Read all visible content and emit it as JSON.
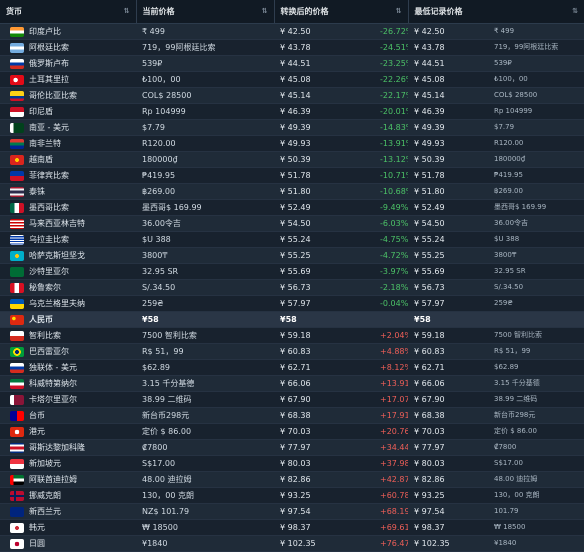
{
  "headers": {
    "currency": "货币",
    "price": "当前价格",
    "converted": "转换后的价格",
    "lowest": "最低记录价格"
  },
  "rows": [
    {
      "name": "印度卢比",
      "price": "₹ 499",
      "converted": "¥ 42.50",
      "pct": "-26.72%",
      "trend": "neg",
      "low": "¥ 42.50",
      "low_raw": "₹ 499",
      "flag": "flag-india"
    },
    {
      "name": "阿根廷比索",
      "price": "719，99阿根廷比索",
      "converted": "¥ 43.78",
      "pct": "-24.51%",
      "trend": "neg",
      "low": "¥ 43.78",
      "low_raw": "719，99阿根廷比索",
      "flag": "flag-argentina"
    },
    {
      "name": "俄罗斯卢布",
      "price": "539₽",
      "converted": "¥ 44.51",
      "pct": "-23.25%",
      "trend": "neg",
      "low": "¥ 44.51",
      "low_raw": "539₽",
      "flag": "flag-russia"
    },
    {
      "name": "土耳其里拉",
      "price": "₺100，00",
      "converted": "¥ 45.08",
      "pct": "-22.26%",
      "trend": "neg",
      "low": "¥ 45.08",
      "low_raw": "₺100，00",
      "flag": "flag-turkey"
    },
    {
      "name": "哥伦比亚比索",
      "price": "COL$ 28500",
      "converted": "¥ 45.14",
      "pct": "-22.17%",
      "trend": "neg",
      "low": "¥ 45.14",
      "low_raw": "COL$ 28500",
      "flag": "flag-colombia"
    },
    {
      "name": "印尼盾",
      "price": "Rp 104999",
      "converted": "¥ 46.39",
      "pct": "-20.01%",
      "trend": "neg",
      "low": "¥ 46.39",
      "low_raw": "Rp 104999",
      "flag": "flag-indonesia"
    },
    {
      "name": "南亚 - 美元",
      "price": "$7.79",
      "converted": "¥ 49.39",
      "pct": "-14.83%",
      "trend": "neg",
      "low": "¥ 49.39",
      "low_raw": "$7.79",
      "flag": "flag-pakistan"
    },
    {
      "name": "南非兰特",
      "price": "R120.00",
      "converted": "¥ 49.93",
      "pct": "-13.91%",
      "trend": "neg",
      "low": "¥ 49.93",
      "low_raw": "R120.00",
      "flag": "flag-southafrica"
    },
    {
      "name": "越南盾",
      "price": "180000₫",
      "converted": "¥ 50.39",
      "pct": "-13.12%",
      "trend": "neg",
      "low": "¥ 50.39",
      "low_raw": "180000₫",
      "flag": "flag-vietnam"
    },
    {
      "name": "菲律宾比索",
      "price": "₱419.95",
      "converted": "¥ 51.78",
      "pct": "-10.71%",
      "trend": "neg",
      "low": "¥ 51.78",
      "low_raw": "₱419.95",
      "flag": "flag-philippines"
    },
    {
      "name": "泰铢",
      "price": "฿269.00",
      "converted": "¥ 51.80",
      "pct": "-10.68%",
      "trend": "neg",
      "low": "¥ 51.80",
      "low_raw": "฿269.00",
      "flag": "flag-thailand"
    },
    {
      "name": "墨西哥比索",
      "price": "墨西哥$ 169.99",
      "converted": "¥ 52.49",
      "pct": "-9.49%",
      "trend": "neg",
      "low": "¥ 52.49",
      "low_raw": "墨西哥$ 169.99",
      "flag": "flag-mexico"
    },
    {
      "name": "马来西亚林吉特",
      "price": "36.00令吉",
      "converted": "¥ 54.50",
      "pct": "-6.03%",
      "trend": "neg",
      "low": "¥ 54.50",
      "low_raw": "36.00令吉",
      "flag": "flag-malaysia"
    },
    {
      "name": "乌拉圭比索",
      "price": "$U 388",
      "converted": "¥ 55.24",
      "pct": "-4.75%",
      "trend": "neg",
      "low": "¥ 55.24",
      "low_raw": "$U 388",
      "flag": "flag-uruguay"
    },
    {
      "name": "哈萨克斯坦坚戈",
      "price": "3800₸",
      "converted": "¥ 55.25",
      "pct": "-4.72%",
      "trend": "neg",
      "low": "¥ 55.25",
      "low_raw": "3800₸",
      "flag": "flag-kazakhstan"
    },
    {
      "name": "沙特里亚尔",
      "price": "32.95 SR",
      "converted": "¥ 55.69",
      "pct": "-3.97%",
      "trend": "neg",
      "low": "¥ 55.69",
      "low_raw": "32.95 SR",
      "flag": "flag-saudi"
    },
    {
      "name": "秘鲁索尔",
      "price": "S/.34.50",
      "converted": "¥ 56.73",
      "pct": "-2.18%",
      "trend": "neg",
      "low": "¥ 56.73",
      "low_raw": "S/.34.50",
      "flag": "flag-peru"
    },
    {
      "name": "乌克兰格里夫纳",
      "price": "259₴",
      "converted": "¥ 57.97",
      "pct": "-0.04%",
      "trend": "neg",
      "low": "¥ 57.97",
      "low_raw": "259₴",
      "flag": "flag-ukraine"
    },
    {
      "name": "人民币",
      "price": "¥58",
      "converted": "¥58",
      "pct": "",
      "trend": "flat",
      "low": "¥58",
      "low_raw": "",
      "flag": "flag-china",
      "highlight": true
    },
    {
      "name": "智利比索",
      "price": "7500 智利比索",
      "converted": "¥ 59.18",
      "pct": "+2.04%",
      "trend": "pos",
      "low": "¥ 59.18",
      "low_raw": "7500 智利比索",
      "flag": "flag-chile"
    },
    {
      "name": "巴西雷亚尔",
      "price": "R$ 51，99",
      "converted": "¥ 60.83",
      "pct": "+4.88%",
      "trend": "pos",
      "low": "¥ 60.83",
      "low_raw": "R$ 51，99",
      "flag": "flag-brazil"
    },
    {
      "name": "独联体 - 美元",
      "price": "$62.89",
      "converted": "¥ 62.71",
      "pct": "+8.12%",
      "trend": "pos",
      "low": "¥ 62.71",
      "low_raw": "$62.89",
      "flag": "flag-cis"
    },
    {
      "name": "科威特第纳尔",
      "price": "3.15 千分基德",
      "converted": "¥ 66.06",
      "pct": "+13.91%",
      "trend": "pos",
      "low": "¥ 66.06",
      "low_raw": "3.15 千分基德",
      "flag": "flag-kuwait"
    },
    {
      "name": "卡塔尔里亚尔",
      "price": "38.99 二维码",
      "converted": "¥ 67.90",
      "pct": "+17.07%",
      "trend": "pos",
      "low": "¥ 67.90",
      "low_raw": "38.99 二维码",
      "flag": "flag-qatar"
    },
    {
      "name": "台币",
      "price": "新台币298元",
      "converted": "¥ 68.38",
      "pct": "+17.91%",
      "trend": "pos",
      "low": "¥ 68.38",
      "low_raw": "新台币298元",
      "flag": "flag-taiwan"
    },
    {
      "name": "港元",
      "price": "定价 $ 86.00",
      "converted": "¥ 70.03",
      "pct": "+20.76%",
      "trend": "pos",
      "low": "¥ 70.03",
      "low_raw": "定价 $ 86.00",
      "flag": "flag-hongkong"
    },
    {
      "name": "哥斯达黎加科隆",
      "price": "₡7800",
      "converted": "¥ 77.97",
      "pct": "+34.44%",
      "trend": "pos",
      "low": "¥ 77.97",
      "low_raw": "₡7800",
      "flag": "flag-costarica"
    },
    {
      "name": "新加坡元",
      "price": "S$17.00",
      "converted": "¥ 80.03",
      "pct": "+37.98%",
      "trend": "pos",
      "low": "¥ 80.03",
      "low_raw": "S$17.00",
      "flag": "flag-singapore"
    },
    {
      "name": "阿联酋迪拉姆",
      "price": "48.00 迪拉姆",
      "converted": "¥ 82.86",
      "pct": "+42.87%",
      "trend": "pos",
      "low": "¥ 82.86",
      "low_raw": "48.00 迪拉姆",
      "flag": "flag-uae"
    },
    {
      "name": "挪威克朗",
      "price": "130，00 克朗",
      "converted": "¥ 93.25",
      "pct": "+60.78%",
      "trend": "pos",
      "low": "¥ 93.25",
      "low_raw": "130，00 克朗",
      "flag": "flag-norway"
    },
    {
      "name": "新西兰元",
      "price": "NZ$ 101.79",
      "converted": "¥ 97.54",
      "pct": "+68.19%",
      "trend": "pos",
      "low": "¥ 97.54",
      "low_raw": "101.79",
      "flag": "flag-newzealand"
    },
    {
      "name": "韩元",
      "price": "₩ 18500",
      "converted": "¥ 98.37",
      "pct": "+69.61%",
      "trend": "pos",
      "low": "¥ 98.37",
      "low_raw": "₩ 18500",
      "flag": "flag-korea"
    },
    {
      "name": "日圆",
      "price": "¥1840",
      "converted": "¥ 102.35",
      "pct": "+76.47%",
      "trend": "pos",
      "low": "¥ 102.35",
      "low_raw": "¥1840",
      "flag": "flag-japan"
    }
  ]
}
